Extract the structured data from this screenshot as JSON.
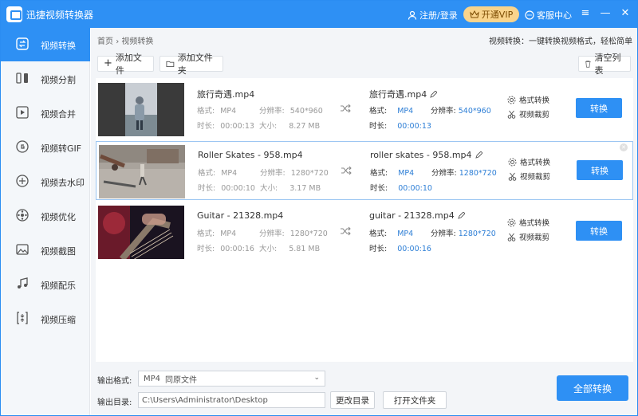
{
  "app": {
    "title": "迅捷视频转换器"
  },
  "titlebar": {
    "login": "注册/登录",
    "vip": "开通VIP",
    "service": "客服中心"
  },
  "sidebar": {
    "items": [
      {
        "label": "视频转换",
        "icon": "convert-icon"
      },
      {
        "label": "视频分割",
        "icon": "split-icon"
      },
      {
        "label": "视频合并",
        "icon": "merge-icon"
      },
      {
        "label": "视频转GIF",
        "icon": "gif-icon"
      },
      {
        "label": "视频去水印",
        "icon": "watermark-icon"
      },
      {
        "label": "视频优化",
        "icon": "optimize-icon"
      },
      {
        "label": "视频截图",
        "icon": "screenshot-icon"
      },
      {
        "label": "视频配乐",
        "icon": "music-icon"
      },
      {
        "label": "视频压缩",
        "icon": "compress-icon"
      }
    ]
  },
  "breadcrumb": {
    "home": "首页",
    "sep": "›",
    "current": "视频转换"
  },
  "tip": "视频转换：一键转换视频格式，轻松简单",
  "toolbar": {
    "add_file": "添加文件",
    "add_folder": "添加文件夹",
    "clear_list": "清空列表"
  },
  "labels": {
    "format": "格式:",
    "resolution": "分辨率:",
    "duration": "时长:",
    "size": "大小:",
    "format_convert": "格式转换",
    "video_cut": "视频裁剪",
    "convert": "转换"
  },
  "files": [
    {
      "name": "旅行奇遇.mp4",
      "format": "MP4",
      "resolution": "540*960",
      "duration": "00:00:13",
      "size": "8.27 MB",
      "out_name": "旅行奇遇.mp4",
      "out_format": "MP4",
      "out_resolution": "540*960",
      "out_duration": "00:00:13"
    },
    {
      "name": "Roller Skates - 958.mp4",
      "format": "MP4",
      "resolution": "1280*720",
      "duration": "00:00:10",
      "size": "3.17 MB",
      "out_name": "roller skates - 958.mp4",
      "out_format": "MP4",
      "out_resolution": "1280*720",
      "out_duration": "00:00:10"
    },
    {
      "name": "Guitar - 21328.mp4",
      "format": "MP4",
      "resolution": "1280*720",
      "duration": "00:00:16",
      "size": "5.81 MB",
      "out_name": "guitar - 21328.mp4",
      "out_format": "MP4",
      "out_resolution": "1280*720",
      "out_duration": "00:00:16"
    }
  ],
  "bottom": {
    "output_format_label": "输出格式:",
    "output_format_value": "MP4",
    "output_format_quality": "同原文件",
    "output_dir_label": "输出目录:",
    "output_dir_value": "C:\\Users\\Administrator\\Desktop",
    "change_dir": "更改目录",
    "open_folder": "打开文件夹",
    "convert_all": "全部转换"
  },
  "colors": {
    "accent": "#2e90f4",
    "vip_bg": "#f9d48c",
    "value_blue": "#2e7fd6"
  }
}
